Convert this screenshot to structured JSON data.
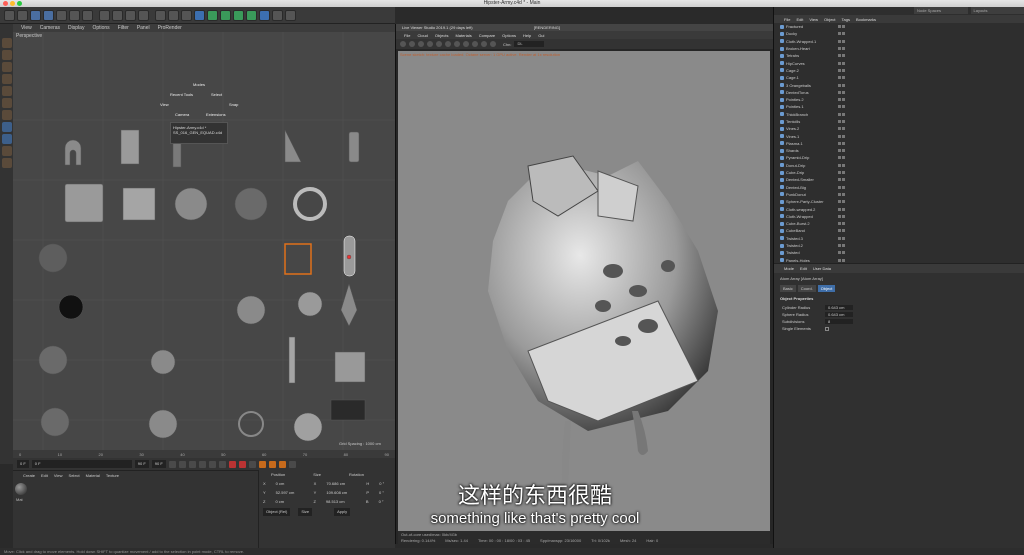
{
  "window": {
    "title": "Hipster-Army.c4d * - Main"
  },
  "viewport": {
    "label": "Perspective",
    "menu": [
      "View",
      "Cameras",
      "Display",
      "Options",
      "Filter",
      "Panel",
      "ProRender"
    ],
    "grid_spacing": "Grid Spacing : 1000 cm",
    "context_menu": {
      "modes": "Modes",
      "recent_tools": "Recent Tools",
      "select": "Select",
      "view": "View",
      "snap": "Snap",
      "camera": "Camera",
      "extensions": "Extensions"
    },
    "popup_items": [
      "Hipster-Army.c4d *",
      "SS_016_GEN_EQUAD.c4d"
    ]
  },
  "timeline": {
    "ticks": [
      "0",
      "5",
      "10",
      "15",
      "20",
      "25",
      "30",
      "35",
      "40",
      "45",
      "50",
      "55",
      "60",
      "65",
      "70",
      "75",
      "80",
      "85",
      "90"
    ],
    "start": "0 F",
    "current": "0 F",
    "end": "90 F",
    "end2": "90 F"
  },
  "material": {
    "menu": [
      "Create",
      "Edit",
      "View",
      "Select",
      "Material",
      "Texture"
    ],
    "name": "Mat"
  },
  "coords": {
    "headers": [
      "Position",
      "Size",
      "Rotation"
    ],
    "rows": [
      [
        "X",
        "0 cm",
        "X",
        "70.686 cm",
        "H",
        "0 °"
      ],
      [
        "Y",
        "52.597 cm",
        "Y",
        "109.608 cm",
        "P",
        "0 °"
      ],
      [
        "Z",
        "0 cm",
        "Z",
        "98.513 cm",
        "B",
        "0 °"
      ]
    ],
    "mode": "Object (Rel)",
    "size_mode": "Size",
    "apply": "Apply"
  },
  "render": {
    "title": "Live Viewer Studio 2019.1 (29 days left)",
    "status": "[RENDERING]",
    "menu": [
      "File",
      "Cloud",
      "Objects",
      "Materials",
      "Compare",
      "Options",
      "Help",
      "Gui"
    ],
    "channel": "DL",
    "warning": "Scene sketch: texture cache loaded. Octane server: 1 GPU active. Render at 1x resolution",
    "info": [
      "Out-of-core used/max: 0kb/4Gb",
      "Grey8/16: 0/0   Rgb32/64: 0/3"
    ],
    "stats": {
      "rendering": "Rendering: 0.144%",
      "ms_sec": "Ms/sec: 1.44",
      "time": "Time: 00 : 00 : 18/00 : 03 : 45",
      "spp": "Spp/maxspp: 23/16000",
      "tri": "Tri: 0/102k",
      "mesh": "Mesh: 24",
      "hair": "Hair: 0"
    }
  },
  "objects": {
    "top_combos": [
      "Node Spaces",
      "Layouts"
    ],
    "menu": [
      "File",
      "Edit",
      "View",
      "Object",
      "Tags",
      "Bookmarks"
    ],
    "items": [
      "Fractured",
      "Ducky",
      "Cloth-Wrapped.1",
      "Broken-Heart",
      "Tetrahs",
      "HipCurves",
      "Cage.2",
      "Cage.1",
      "3 Orangeballs",
      "DentedTorus",
      "Pointies.2",
      "Pointies.1",
      "ThickBranch",
      "Tentcills",
      "Vines.2",
      "Vines.1",
      "Plasma.1",
      "Shards",
      "Pyramid-Drip",
      "Donut-Drip",
      "Cube-Drip",
      "Dented-Smaller",
      "Dented-Big",
      "PunkDonut",
      "Sphere-Party-Cluster",
      "Cloth-wrapped.2",
      "Cloth-Wrapped",
      "Cube-Burst.2",
      "CubeBand",
      "Twisted.3",
      "Twisted.2",
      "Twisted",
      "Panels-Holes"
    ]
  },
  "attributes": {
    "menu": [
      "Mode",
      "Edit",
      "User Data"
    ],
    "name": "Atom Array [Atom Array]",
    "tabs": [
      "Basic",
      "Coord.",
      "Object"
    ],
    "section": "Object Properties",
    "props": [
      [
        "Cylinder Radius",
        "0.643 cm"
      ],
      [
        "Sphere Radius",
        "0.643 cm"
      ],
      [
        "Subdivisions",
        "8"
      ],
      [
        "Single Elements",
        ""
      ]
    ]
  },
  "statusbar": "Move: Click and drag to move elements. Hold down SHIFT to quantize movement / add to the selection in point mode, CTRL to remove.",
  "subtitle": {
    "zh": "这样的东西很酷",
    "en": "something like that's pretty cool"
  },
  "colors": {
    "accent": "#3f6ea8",
    "render_bg": "#8a8a8a",
    "selection": "#e0701a"
  }
}
